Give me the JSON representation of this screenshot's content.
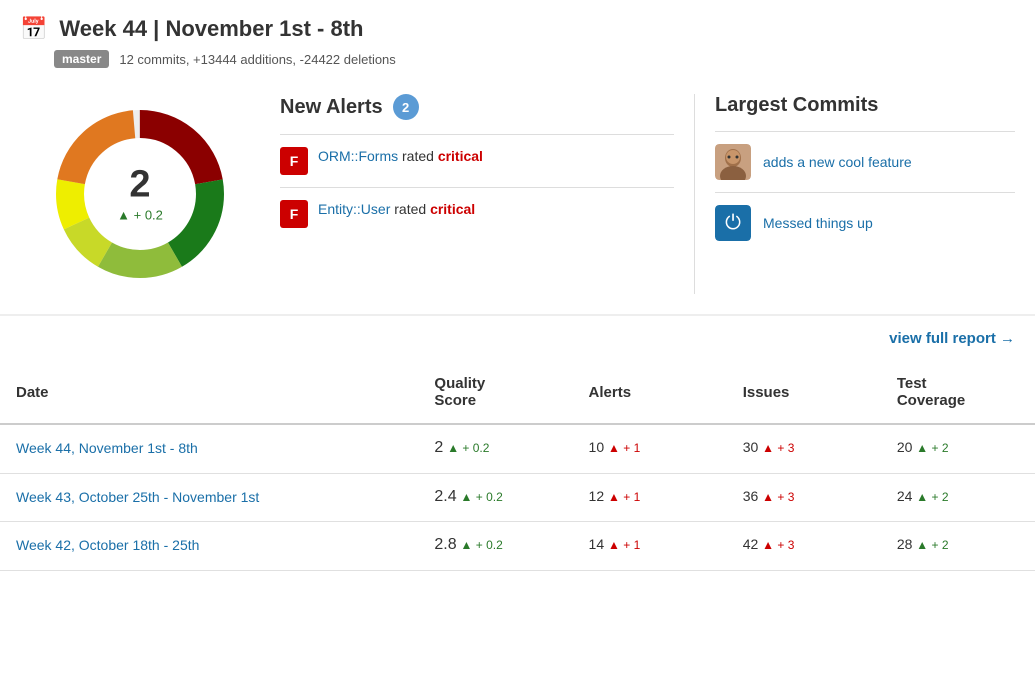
{
  "header": {
    "title": "Week 44 | November 1st - 8th",
    "branch": "master",
    "branch_info": "12 commits, +13444 additions, -24422 deletions"
  },
  "donut": {
    "score": "2",
    "delta": "+ 0.2"
  },
  "alerts": {
    "title": "New Alerts",
    "count": "2",
    "items": [
      {
        "grade": "F",
        "link_text": "ORM::Forms",
        "suffix": " rated ",
        "rating": "critical"
      },
      {
        "grade": "F",
        "link_text": "Entity::User",
        "suffix": " rated ",
        "rating": "critical"
      }
    ]
  },
  "commits": {
    "title": "Largest Commits",
    "items": [
      {
        "avatar_type": "photo",
        "link_text": "adds a new cool feature"
      },
      {
        "avatar_type": "power",
        "link_text": "Messed things up"
      }
    ]
  },
  "view_report": "view full report",
  "table": {
    "columns": [
      "Date",
      "Quality\nScore",
      "Alerts",
      "Issues",
      "Test\nCoverage"
    ],
    "rows": [
      {
        "date": "Week 44, November 1st - 8th",
        "score": "2",
        "score_delta": "+ 0.2",
        "alerts": "10",
        "alerts_delta": "+ 1",
        "issues": "30",
        "issues_delta": "+ 3",
        "coverage": "20",
        "coverage_delta": "+ 2"
      },
      {
        "date": "Week 43, October 25th - November 1st",
        "score": "2.4",
        "score_delta": "+ 0.2",
        "alerts": "12",
        "alerts_delta": "+ 1",
        "issues": "36",
        "issues_delta": "+ 3",
        "coverage": "24",
        "coverage_delta": "+ 2"
      },
      {
        "date": "Week 42, October 18th - 25th",
        "score": "2.8",
        "score_delta": "+ 0.2",
        "alerts": "14",
        "alerts_delta": "+ 1",
        "issues": "42",
        "issues_delta": "+ 3",
        "coverage": "28",
        "coverage_delta": "+ 2"
      }
    ]
  }
}
